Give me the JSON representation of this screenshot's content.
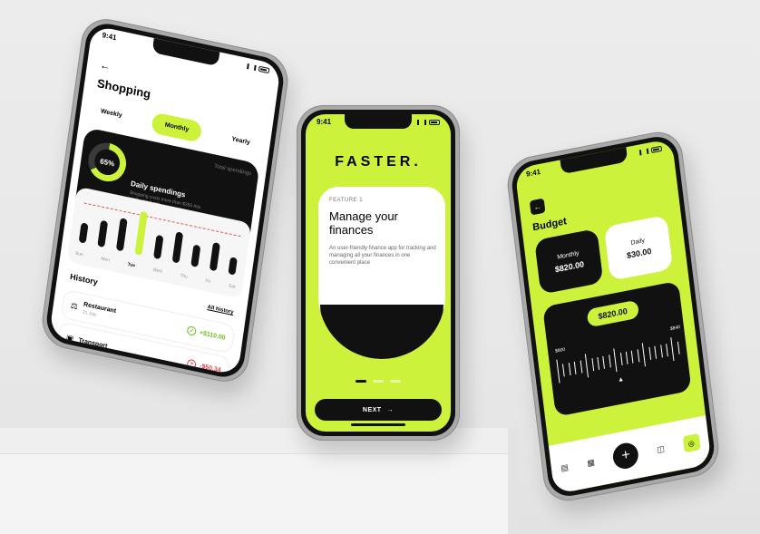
{
  "status_time": "9:41",
  "colors": {
    "accent": "#cdf23c",
    "dark": "#111111",
    "background": "#ececec"
  },
  "shopping": {
    "back_icon": "arrow-left-icon",
    "title": "Shopping",
    "tabs": [
      "Weekly",
      "Monthly",
      "Yearly"
    ],
    "active_tab": "Monthly",
    "donut_percent": "65%",
    "donut_value": 0.65,
    "total_label": "Total spendings",
    "daily_title": "Daily spendings",
    "daily_sub": "Shopping costs more than $250 this week, good job!",
    "chart": {
      "days": [
        "Sun",
        "Mon",
        "Tue",
        "Wed",
        "Thu",
        "Fri",
        "Sat"
      ],
      "selected_day": "Tue",
      "bar_levels": [
        0.45,
        0.6,
        0.75,
        1.0,
        0.55,
        0.7,
        0.5,
        0.65,
        0.4
      ]
    },
    "history_title": "History",
    "history_link": "All history",
    "rows": [
      {
        "icon": "restaurant-icon",
        "name": "Restaurant",
        "date": "21 July",
        "amount": "+$110.00",
        "positive": true
      },
      {
        "icon": "transport-icon",
        "name": "Transport",
        "date": "",
        "amount": "-$50.34",
        "positive": false
      }
    ]
  },
  "onboarding": {
    "brand": "FASTER.",
    "feature_label": "FEATURE 1",
    "heading": "Manage your finances",
    "description": "An user-friendly finance app for tracking and managing all your finances in one convenient place",
    "next_label": "NEXT",
    "next_icon": "arrow-right-icon",
    "active_dot": 0,
    "dot_count": 3
  },
  "budget": {
    "back_icon": "arrow-left-icon",
    "title": "Budget",
    "monthly_label": "Monthly",
    "monthly_value": "$820.00",
    "daily_label": "Daily",
    "daily_value": "$30.00",
    "slider_value": "$820.00",
    "slider_min": "$800",
    "slider_max": "$840",
    "nav": [
      "wallet-icon",
      "grid-icon",
      "plus-icon",
      "chat-icon",
      "settings-icon"
    ]
  }
}
